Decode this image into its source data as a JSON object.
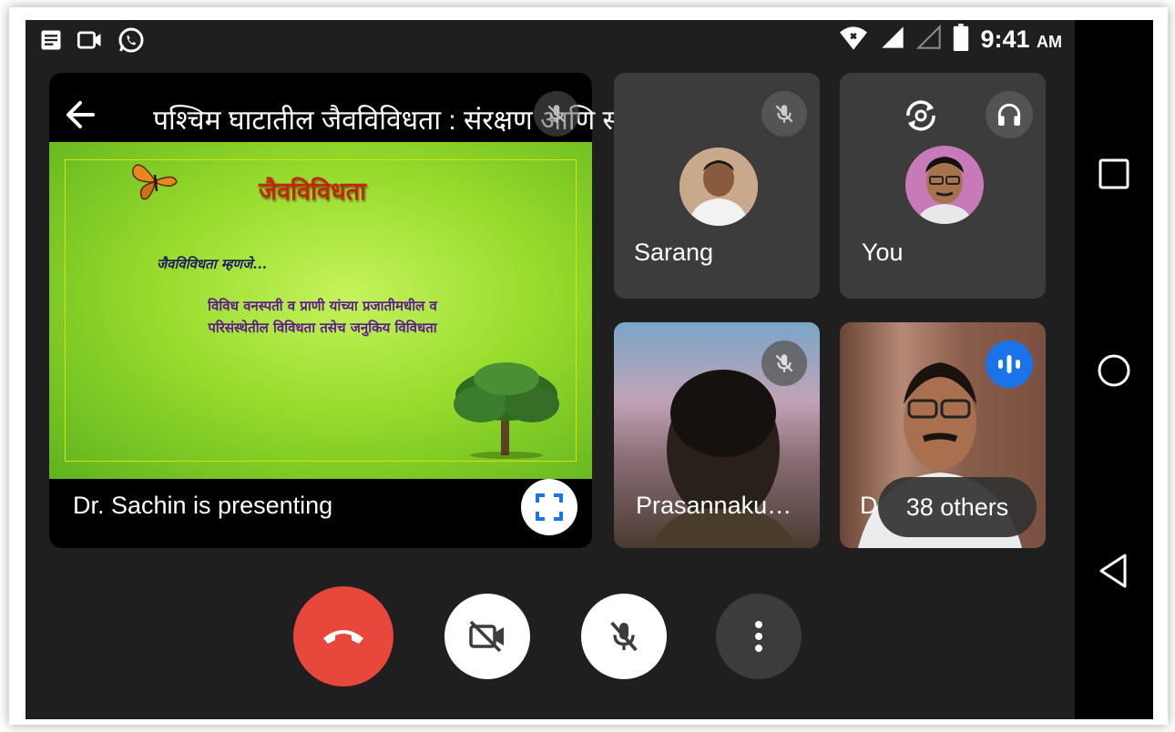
{
  "status_bar": {
    "time": "9:41",
    "ampm": "AM",
    "icons": [
      "notes-icon",
      "video-camera-icon",
      "whatsapp-icon",
      "wifi-icon",
      "signal-icon",
      "signal-empty-icon",
      "battery-icon"
    ]
  },
  "presentation": {
    "title": "पश्चिम घाटातील जैवविविधता : संरक्षण आणि संवर्धन",
    "presenting_label": "Dr.  Sachin is presenting",
    "slide": {
      "heading": "जैवविविधता",
      "subheading": "जैवविविधता म्हणजे...",
      "body_line1": "विविध वनस्पती व प्राणी यांच्या प्रजातीमधील व",
      "body_line2": "परिसंस्थेतील विविधता तसेच जनुकिय विविधता"
    }
  },
  "participants": [
    {
      "name": "Sarang",
      "muted": true
    },
    {
      "name": "You",
      "muted": false
    },
    {
      "name": "Prasannaku…",
      "muted": true
    },
    {
      "name": "Dr",
      "speaking": true
    }
  ],
  "others_label": "38 others",
  "controls": [
    "end-call",
    "camera-off",
    "mic-off",
    "more-options"
  ],
  "colors": {
    "end_call": "#e8473c",
    "speaking_indicator": "#1a73e8",
    "background": "#1f1f1f",
    "tile": "#3c3c3c"
  }
}
